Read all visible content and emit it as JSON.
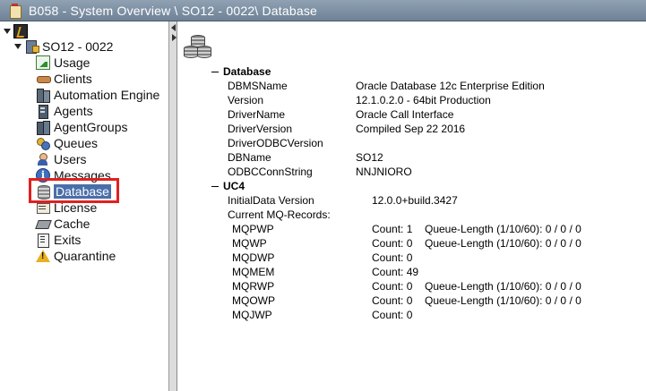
{
  "window": {
    "title": "B058 - System Overview \\ SO12 - 0022\\ Database"
  },
  "tree": {
    "root_icon": "root-icon",
    "server": {
      "label": "SO12 - 0022",
      "icon": "server-icon"
    },
    "items": [
      {
        "label": "Usage",
        "icon": "usage-icon"
      },
      {
        "label": "Clients",
        "icon": "clients-icon"
      },
      {
        "label": "Automation Engine",
        "icon": "automation-engine-icon"
      },
      {
        "label": "Agents",
        "icon": "agents-icon"
      },
      {
        "label": "AgentGroups",
        "icon": "agentgroups-icon"
      },
      {
        "label": "Queues",
        "icon": "queues-icon"
      },
      {
        "label": "Users",
        "icon": "users-icon"
      },
      {
        "label": "Messages",
        "icon": "messages-icon"
      },
      {
        "label": "Database",
        "icon": "database-icon",
        "selected": true
      },
      {
        "label": "License",
        "icon": "license-icon"
      },
      {
        "label": "Cache",
        "icon": "cache-icon"
      },
      {
        "label": "Exits",
        "icon": "exits-icon"
      },
      {
        "label": "Quarantine",
        "icon": "quarantine-icon"
      }
    ]
  },
  "details": {
    "database": {
      "title": "Database",
      "fields": [
        {
          "key": "DBMSName",
          "value": "Oracle Database 12c Enterprise Edition"
        },
        {
          "key": "Version",
          "value": "12.1.0.2.0 - 64bit Production"
        },
        {
          "key": "DriverName",
          "value": "Oracle Call Interface"
        },
        {
          "key": "DriverVersion",
          "value": "Compiled Sep 22 2016"
        },
        {
          "key": "DriverODBCVersion",
          "value": ""
        },
        {
          "key": "DBName",
          "value": "SO12"
        },
        {
          "key": "ODBCConnString",
          "value": "NNJNIORO"
        }
      ]
    },
    "uc4": {
      "title": "UC4",
      "initial_data_label": "InitialData Version",
      "initial_data_value": "12.0.0+build.3427",
      "mq_label": "Current MQ-Records:",
      "mq_records": [
        {
          "name": "MQPWP",
          "count": "Count: 1",
          "queue": "Queue-Length (1/10/60): 0 / 0 / 0"
        },
        {
          "name": "MQWP",
          "count": "Count: 0",
          "queue": "Queue-Length (1/10/60): 0 / 0 / 0"
        },
        {
          "name": "MQDWP",
          "count": "Count: 0",
          "queue": ""
        },
        {
          "name": "MQMEM",
          "count": "Count: 49",
          "queue": ""
        },
        {
          "name": "MQRWP",
          "count": "Count: 0",
          "queue": "Queue-Length (1/10/60): 0 / 0 / 0"
        },
        {
          "name": "MQOWP",
          "count": "Count: 0",
          "queue": "Queue-Length (1/10/60): 0 / 0 / 0"
        },
        {
          "name": "MQJWP",
          "count": "Count: 0",
          "queue": ""
        }
      ]
    }
  }
}
